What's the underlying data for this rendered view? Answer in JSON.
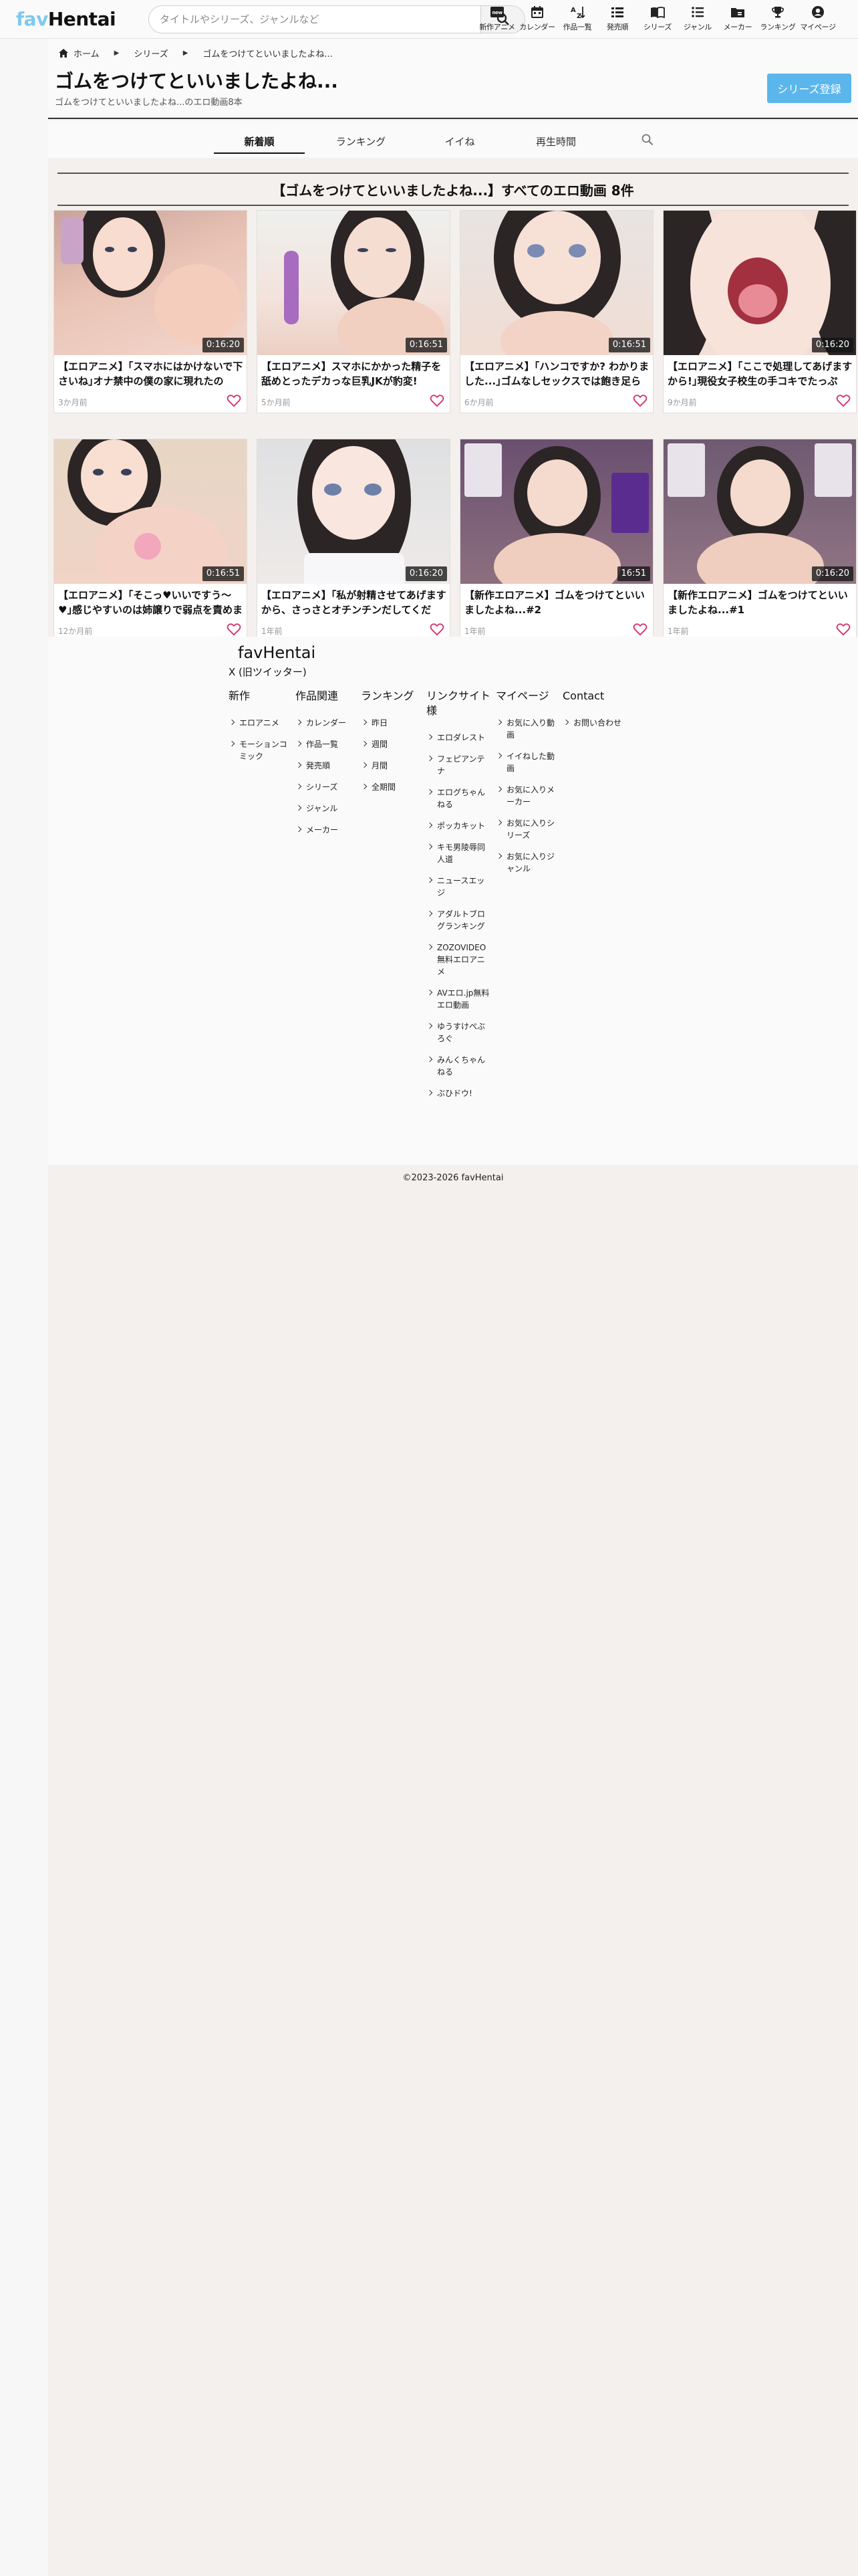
{
  "header": {
    "logo_fav": "fav",
    "logo_hentai": "Hentai",
    "search_placeholder": "タイトルやシリーズ、ジャンルなど",
    "nav": [
      {
        "label": "新作アニメ",
        "icon": "new-badge-icon"
      },
      {
        "label": "カレンダー",
        "icon": "calendar-icon"
      },
      {
        "label": "作品一覧",
        "icon": "az-sort-icon"
      },
      {
        "label": "発売順",
        "icon": "list-icon"
      },
      {
        "label": "シリーズ",
        "icon": "book-icon"
      },
      {
        "label": "ジャンル",
        "icon": "bullet-list-icon"
      },
      {
        "label": "メーカー",
        "icon": "folder-icon"
      },
      {
        "label": "ランキング",
        "icon": "trophy-icon"
      },
      {
        "label": "マイページ",
        "icon": "account-icon"
      }
    ]
  },
  "breadcrumb": {
    "home": "ホーム",
    "series": "シリーズ",
    "current": "ゴムをつけてといいましたよね..."
  },
  "series": {
    "title": "ゴムをつけてといいましたよね...",
    "subtitle": "ゴムをつけてといいましたよね...のエロ動画8本",
    "register_label": "シリーズ登録"
  },
  "tabs": [
    "新着順",
    "ランキング",
    "イイね",
    "再生時間"
  ],
  "list_heading": "【ゴムをつけてといいましたよね...】すべてのエロ動画 8件",
  "videos": [
    {
      "title": "【エロアニメ】｢スマホにはかけないで下さいね｣オナ禁中の僕の家に現れたのは...",
      "duration": "0:16:20",
      "date": "3か月前"
    },
    {
      "title": "【エロアニメ】スマホにかかった精子を舐めとったデカっな巨乳JKが豹変!「本...",
      "duration": "0:16:51",
      "date": "5か月前"
    },
    {
      "title": "【エロアニメ】｢ハンコですか? わかりました...｣ゴムなしセックスでは飽き足らず...",
      "duration": "0:16:51",
      "date": "6か月前"
    },
    {
      "title": "【エロアニメ】｢ここで処理してあげますから!｣現役女子校生の手コキでたっぷり...",
      "duration": "0:16:20",
      "date": "9か月前"
    },
    {
      "title": "【エロアニメ】｢そこっ♥いいですう〜♥｣感じやすいのは姉譲りで弱点を責めまく...",
      "duration": "0:16:51",
      "date": "12か月前"
    },
    {
      "title": "【エロアニメ】｢私が射精させてあげますから、さっさとオチンチンだしてくださ...",
      "duration": "0:16:20",
      "date": "1年前"
    },
    {
      "title": "【新作エロアニメ】ゴムをつけてといいましたよね...#2",
      "duration": "16:51",
      "date": "1年前"
    },
    {
      "title": "【新作エロアニメ】ゴムをつけてといいましたよね...#1",
      "duration": "0:16:20",
      "date": "1年前"
    }
  ],
  "footer": {
    "logo": "favHentai",
    "x_label": "X (旧ツイッター)",
    "columns": [
      {
        "heading": "新作",
        "items": [
          "エロアニメ",
          "モーションコミック"
        ]
      },
      {
        "heading": "作品関連",
        "items": [
          "カレンダー",
          "作品一覧",
          "発売順",
          "シリーズ",
          "ジャンル",
          "メーカー"
        ]
      },
      {
        "heading": "ランキング",
        "items": [
          "昨日",
          "週間",
          "月間",
          "全期間"
        ]
      },
      {
        "heading": "リンクサイト様",
        "items": [
          "エロダレスト",
          "フェピアンテナ",
          "エログちゃんねる",
          "ポッカキット",
          "キモ男陵辱同人道",
          "ニュースエッジ",
          "アダルトブログランキング",
          "ZOZOVIDEO無料エロアニメ",
          "AVエロ.jp無料エロ動画",
          "ゆうすけぺぶろぐ",
          "みんくちゃんねる",
          "ぶひドウ!"
        ]
      },
      {
        "heading": "マイページ",
        "items": [
          "お気に入り動画",
          "イイねした動画",
          "お気に入りメーカー",
          "お気に入りシリーズ",
          "お気に入りジャンル"
        ]
      },
      {
        "heading": "Contact",
        "items": [
          "お問い合わせ"
        ]
      }
    ],
    "copyright": "©2023-2026 favHentai"
  }
}
